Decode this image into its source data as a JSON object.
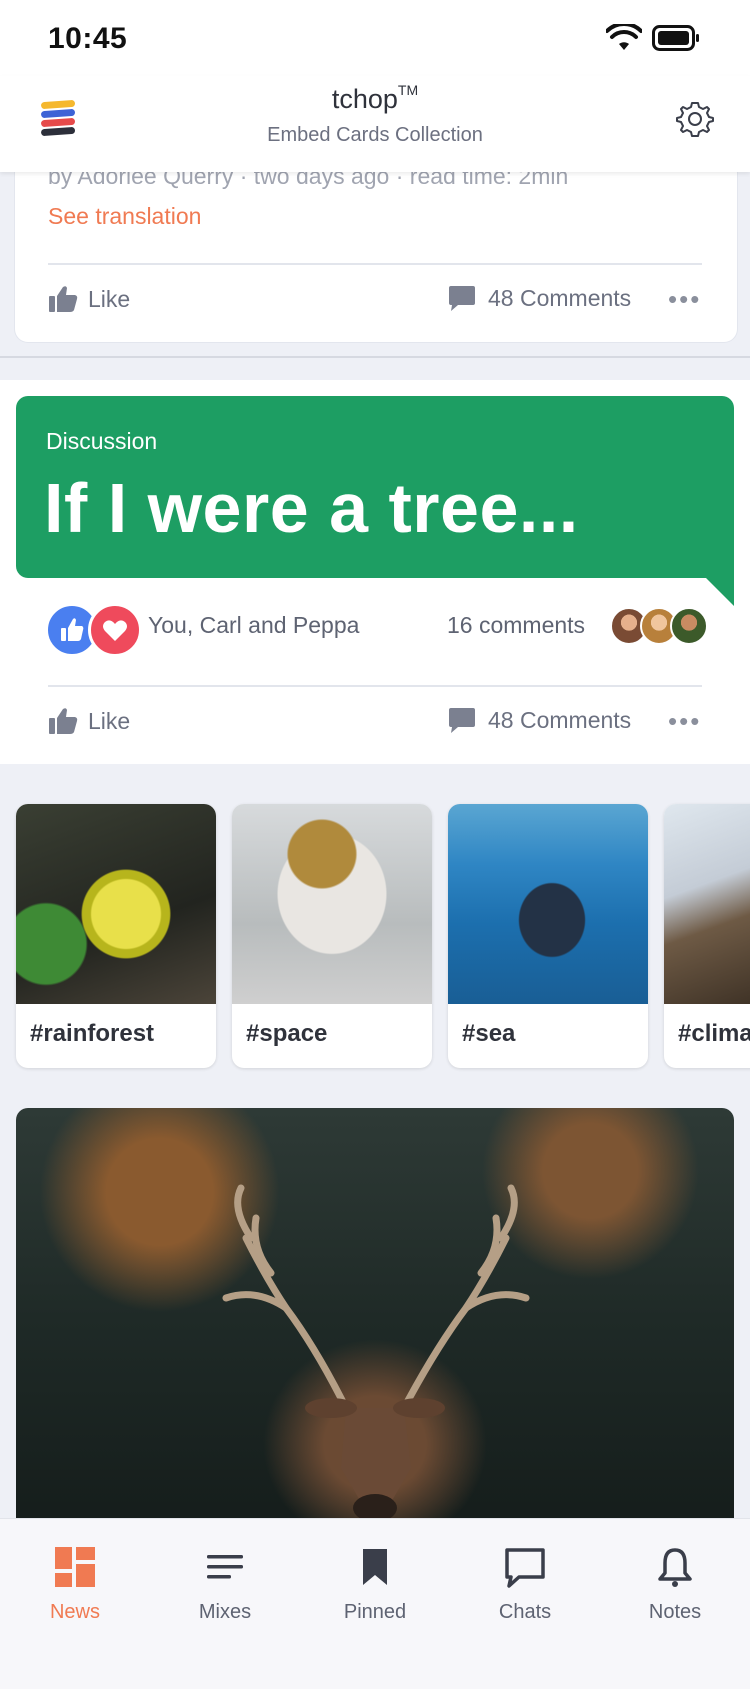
{
  "status_bar": {
    "time": "10:45"
  },
  "header": {
    "title": "tchop",
    "title_mark": "TM",
    "subtitle": "Embed Cards Collection"
  },
  "post1": {
    "meta": "by Adoriee Querry · two days ago · read time: 2min",
    "translate_link": "See translation",
    "like_label": "Like",
    "comments_label": "48 Comments",
    "more": "•••"
  },
  "discussion": {
    "label": "Discussion",
    "title": "If I were a tree...",
    "reactors": "You, Carl and Peppa",
    "comment_count": "16 comments",
    "like_label": "Like",
    "comments_label": "48 Comments",
    "more": "•••"
  },
  "topics": [
    {
      "label": "#rainforest"
    },
    {
      "label": "#space"
    },
    {
      "label": "#sea"
    },
    {
      "label": "#clima"
    }
  ],
  "bottom_nav": [
    {
      "label": "News",
      "icon": "grid-icon",
      "active": true
    },
    {
      "label": "Mixes",
      "icon": "lines-icon"
    },
    {
      "label": "Pinned",
      "icon": "bookmark-icon"
    },
    {
      "label": "Chats",
      "icon": "chat-icon"
    },
    {
      "label": "Notes",
      "icon": "bell-icon"
    }
  ],
  "colors": {
    "accent": "#f07a52",
    "discussion_green": "#1d9e63",
    "like_blue": "#4a7ff0",
    "heart_red": "#ef4a5c"
  }
}
